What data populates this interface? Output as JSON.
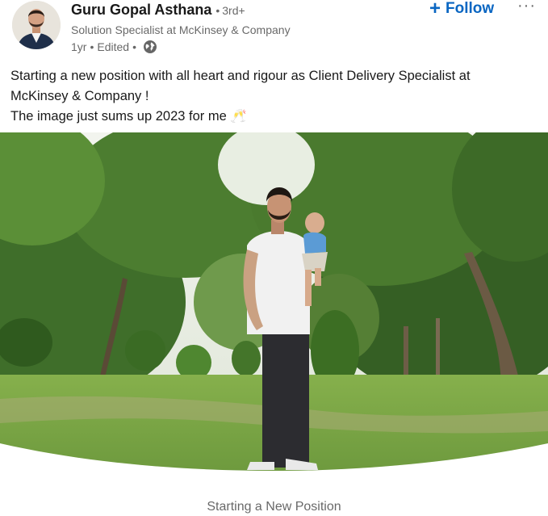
{
  "author": {
    "name": "Guru Gopal Asthana",
    "separator": "•",
    "degree": "3rd+",
    "headline": "Solution Specialist at McKinsey & Company",
    "time": "1yr",
    "edited": "Edited",
    "visibility_icon": "globe-icon"
  },
  "actions": {
    "follow_icon": "plus-icon",
    "follow_label": "Follow",
    "more_label": "···"
  },
  "post": {
    "line1": "Starting a new position with all heart and rigour as Client Delivery Specialist at McKinsey & Company !",
    "line2": "The image just sums up 2023 for me 🥂"
  },
  "image": {
    "caption": "Starting a New Position"
  },
  "colors": {
    "accent": "#0a66c2",
    "text_primary": "rgba(0,0,0,0.9)",
    "text_secondary": "rgba(0,0,0,0.6)"
  }
}
